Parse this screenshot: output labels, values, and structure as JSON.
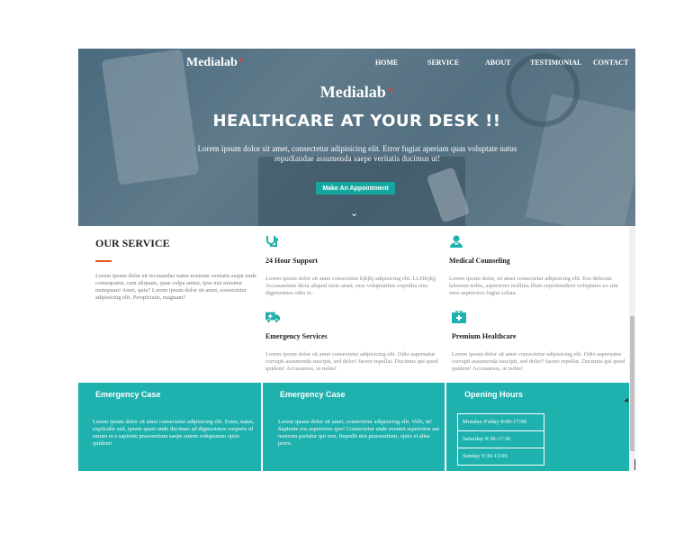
{
  "nav": {
    "logo": "Medialab",
    "items": [
      "HOME",
      "SERVICE",
      "ABOUT",
      "TESTIMONIAL",
      "CONTACT"
    ]
  },
  "hero": {
    "logo": "Medialab",
    "title": "HEALTHCARE AT YOUR DESK !!",
    "text": "Lorem ipsum dolor sit amet, consectetur adipisicing elit. Error fugiat aperiam quas voluptate natus repudiandae assumenda saepe veritatis ducimus ut!",
    "cta": "Make An Appointment"
  },
  "service": {
    "heading": "OUR SERVICE",
    "text": "Lorem ipsum dolor sit recusandae natus nostrum veritatis sequi unde consequatur, cum aliquam, quae culpa animi, ipsa nisi maxime numquam! Amet, quia? Lorem ipsum dolor sit amet, consectetur adipisicing elit. Perspiciatis, magnam?",
    "cards": [
      {
        "icon": "stethoscope-icon",
        "title": "24 Hour Support",
        "text": "Lorem ipsum dolor sit amet consectetur kjkjkj adipisicing elit. LLHKjkjj Accusantium dicta aliquid iusto amet, esse voluptatibus expedita eius dignissimos odio et."
      },
      {
        "icon": "doctor-icon",
        "title": "Medical Counseling",
        "text": "Lorem ipsum dolor, sit amet consectetur adipisicing elit. Eos delectus laborum nobis, asperiores mollitia illum reprehenderit voluptates ex sint vero asperiores fugiat soluta."
      },
      {
        "icon": "ambulance-icon",
        "title": "Emergency Services",
        "text": "Lorem ipsum dolor sit amet consectetur adipisicing elit. Odio aspernatur corrupti assumenda suscipit, sed dolor! facere repellat. Ducimus qui quod quidem! Accusamus, ut nobis!"
      },
      {
        "icon": "medkit-icon",
        "title": "Premium Healthcare",
        "text": "Lorem ipsum dolor sit amet consectetur adipisicing elit. Odio aspernatur corrupti assumenda suscipit, sed dolor? facere repellat. Ducimus qui quod quidem! Accusamus, ut nobis!"
      }
    ]
  },
  "bottom": {
    "col1": {
      "title": "Emergency Case",
      "text": "Lorem ipsum dolor sit amet consectetur adipisicing elit. Enim, natus, explicabo sed, ipsum quasi unde ducimus ad dignissimos corporis id earum et a sapiente praesentium saepe autem voluptatum optio quidem!"
    },
    "col2": {
      "title": "Emergency Case",
      "text": "Lorem ipsum dolor sit amet, consectetur adipisicing elit. Velit, ut! Sapiente eos asperiores quo! Consectetur unde eveniet asperiores aut nostrum pariatur qui non. Impedit nisi praesentium, optio et alias porro."
    },
    "col3": {
      "title": "Opening Hours",
      "hours": [
        "Monday-Friday 8:00-17:00",
        "Saturday 9:30-17:30",
        "Sunday 9:30-15:00"
      ]
    }
  },
  "colors": {
    "accent": "#1eb1ad",
    "brand_plus": "#e53935",
    "service_line": "#e2561a"
  }
}
